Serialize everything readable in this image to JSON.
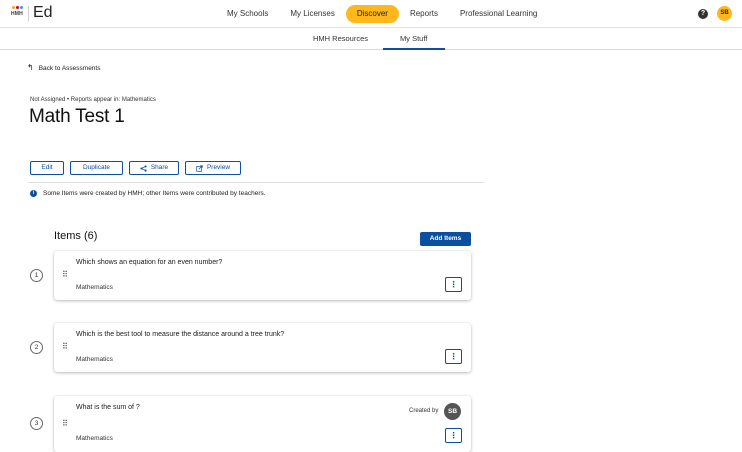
{
  "colors": {
    "accent": "#0b4fa0",
    "nav_active": "#ffb81c"
  },
  "brand": {
    "logo_text": "HMH",
    "app_name": "Ed"
  },
  "nav": {
    "items": [
      {
        "label": "My Schools"
      },
      {
        "label": "My Licenses"
      },
      {
        "label": "Discover"
      },
      {
        "label": "Reports"
      },
      {
        "label": "Professional Learning"
      }
    ],
    "active": "Discover",
    "help_icon": "?",
    "user_initials": "SB"
  },
  "subnav": {
    "tabs": [
      {
        "label": "HMH Resources"
      },
      {
        "label": "My Stuff"
      }
    ],
    "active": "My Stuff"
  },
  "back_link": "Back to Assessments",
  "meta": "Not Assigned • Reports appear in: Mathematics",
  "title": "Math Test 1",
  "actions": {
    "edit": "Edit",
    "duplicate": "Duplicate",
    "share": "Share",
    "preview": "Preview"
  },
  "info_text": "Some Items were created by HMH; other Items were contributed by teachers.",
  "items_heading": "Items (6)",
  "add_items": "Add Items",
  "items": [
    {
      "number": "1",
      "question": "Which shows an equation for an even number?",
      "subject": "Mathematics"
    },
    {
      "number": "2",
      "question": "Which is the best tool to measure the distance around a tree trunk?",
      "subject": "Mathematics"
    },
    {
      "number": "3",
      "question": "What is the sum of ?",
      "subject": "Mathematics",
      "created_by_label": "Created by",
      "creator_initials": "SB"
    }
  ]
}
